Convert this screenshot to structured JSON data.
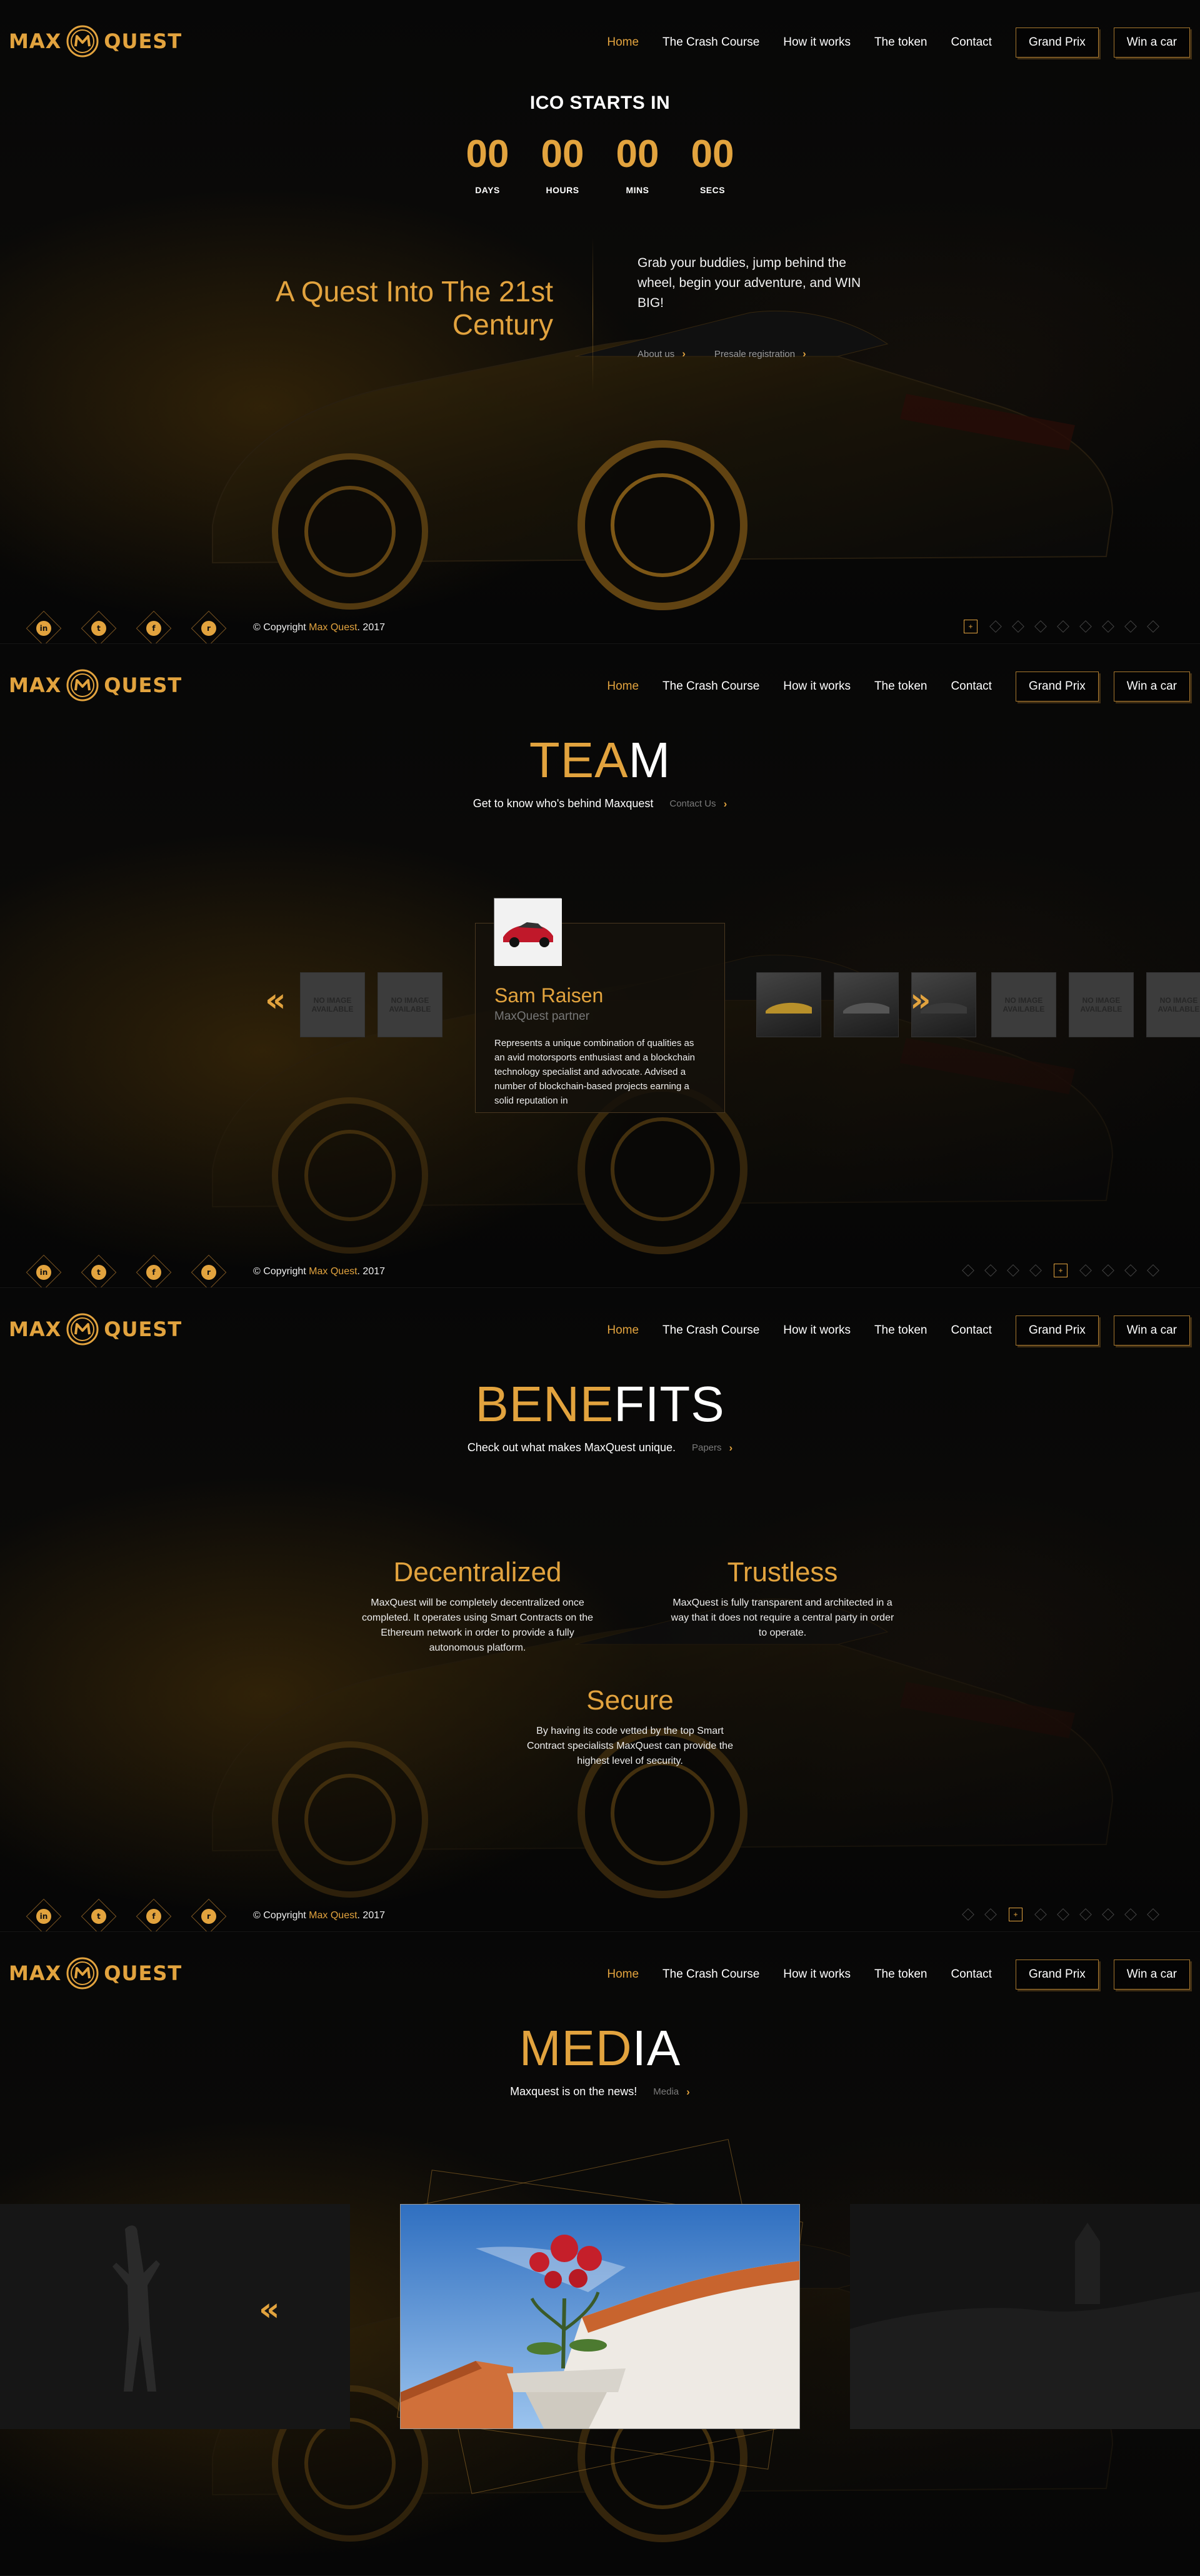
{
  "brand": {
    "word1": "MAX",
    "word2": "QUEST",
    "accent": "#e2a33e"
  },
  "nav": {
    "links": [
      "Home",
      "The Crash Course",
      "How it works",
      "The token",
      "Contact"
    ],
    "buttons": [
      "Grand Prix",
      "Win a car"
    ]
  },
  "hero": {
    "ico_title": "ICO STARTS IN",
    "countdown": [
      {
        "value": "00",
        "label": "DAYS"
      },
      {
        "value": "00",
        "label": "HOURS"
      },
      {
        "value": "00",
        "label": "MINS"
      },
      {
        "value": "00",
        "label": "SECS"
      }
    ],
    "heading": "A Quest Into The 21st Century",
    "text": "Grab your buddies, jump behind the wheel, begin your adventure, and WIN BIG!",
    "links": [
      "About us",
      "Presale registration"
    ]
  },
  "footer": {
    "social": [
      "linkedin-icon",
      "twitter-icon",
      "facebook-icon",
      "reddit-icon"
    ],
    "copyright_prefix": "© Copyright",
    "copyright_brand": "Max Quest",
    "copyright_year": ". 2017"
  },
  "team": {
    "title_gold": "TEA",
    "title_white": "M",
    "subtitle": "Get to know who's behind Maxquest",
    "more": "Contact Us",
    "no_image": "NO IMAGE AVAILABLE",
    "member": {
      "name": "Sam Raisen",
      "role": "MaxQuest partner",
      "bio": "Represents a unique combination of qualities as an avid motorsports enthusiast and a blockchain technology specialist and advocate. Advised a number of blockchain-based projects earning a solid reputation in"
    }
  },
  "benefits": {
    "title_gold": "BENE",
    "title_white": "FITS",
    "subtitle": "Check out what makes MaxQuest unique.",
    "more": "Papers",
    "items": [
      {
        "title": "Decentralized",
        "text": "MaxQuest will be completely decentralized once completed. It operates using Smart Contracts on the Ethereum network in order to provide a fully autonomous platform."
      },
      {
        "title": "Trustless",
        "text": "MaxQuest is fully transparent and architected in a way that it does not require a central party in order to operate."
      },
      {
        "title": "Secure",
        "text": "By having its code vetted by the top Smart Contract specialists MaxQuest can provide the highest level of security."
      }
    ]
  },
  "media": {
    "title_gold": "MED",
    "title_white": "IA",
    "subtitle": "Maxquest is on the news!",
    "more": "Media"
  }
}
